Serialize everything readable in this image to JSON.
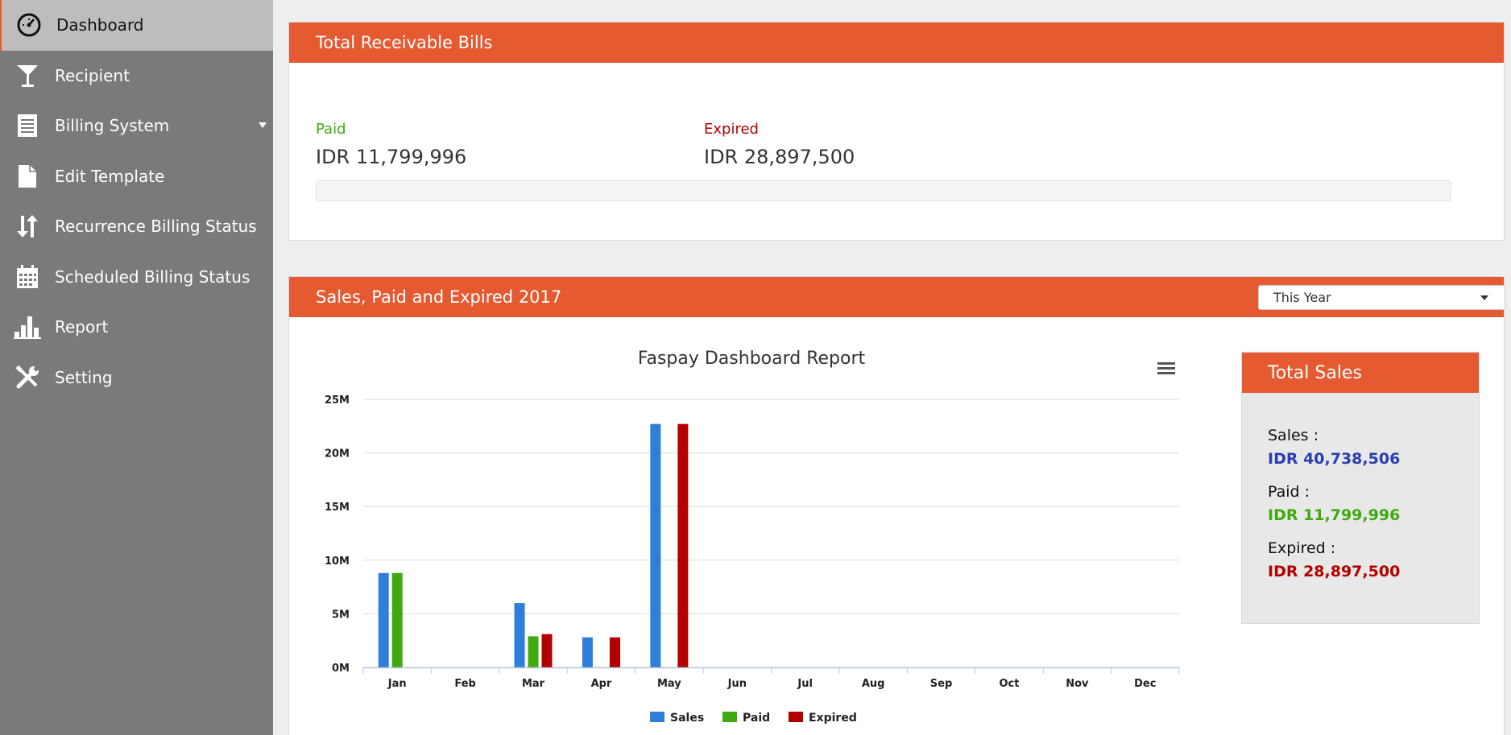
{
  "colors": {
    "accent": "#e55a30",
    "sales": "#2f7ed8",
    "paid": "#40a90f",
    "expired": "#b30000",
    "salesTotal": "#2b3db4"
  },
  "sidebar": {
    "items": [
      {
        "label": "Dashboard",
        "icon": "dashboard-gauge-icon",
        "active": true
      },
      {
        "label": "Recipient",
        "icon": "glass-icon"
      },
      {
        "label": "Billing System",
        "icon": "document-list-icon",
        "hasSubmenu": true
      },
      {
        "label": "Edit Template",
        "icon": "file-icon"
      },
      {
        "label": "Recurrence Billing Status",
        "icon": "sort-arrows-icon"
      },
      {
        "label": "Scheduled Billing Status",
        "icon": "calendar-icon"
      },
      {
        "label": "Report",
        "icon": "bar-chart-icon"
      },
      {
        "label": "Setting",
        "icon": "wrench-icon"
      }
    ]
  },
  "receivable": {
    "title": "Total Receivable Bills",
    "paid_label": "Paid",
    "paid_value": "IDR 11,799,996",
    "expired_label": "Expired",
    "expired_value": "IDR 28,897,500",
    "progress_paid_fraction": 0
  },
  "sales_panel": {
    "title": "Sales, Paid and Expired 2017",
    "period_selected": "This Year"
  },
  "total_sales": {
    "title": "Total Sales",
    "sales_label": "Sales :",
    "sales_value": "IDR 40,738,506",
    "paid_label": "Paid :",
    "paid_value": "IDR 11,799,996",
    "expired_label": "Expired :",
    "expired_value": "IDR 28,897,500"
  },
  "chart_data": {
    "type": "bar",
    "title": "Faspay Dashboard Report",
    "categories": [
      "Jan",
      "Feb",
      "Mar",
      "Apr",
      "May",
      "Jun",
      "Jul",
      "Aug",
      "Sep",
      "Oct",
      "Nov",
      "Dec"
    ],
    "series": [
      {
        "name": "Sales",
        "color": "#2f7ed8",
        "values": [
          8800000,
          0,
          6000000,
          2800000,
          22700000,
          0,
          0,
          0,
          0,
          0,
          0,
          0
        ]
      },
      {
        "name": "Paid",
        "color": "#40a90f",
        "values": [
          8800000,
          0,
          2900000,
          0,
          0,
          0,
          0,
          0,
          0,
          0,
          0,
          0
        ]
      },
      {
        "name": "Expired",
        "color": "#b30000",
        "values": [
          0,
          0,
          3100000,
          2800000,
          22700000,
          0,
          0,
          0,
          0,
          0,
          0,
          0
        ]
      }
    ],
    "ylim": [
      0,
      25000000
    ],
    "yticks": [
      0,
      5000000,
      10000000,
      15000000,
      20000000,
      25000000
    ],
    "ytick_labels": [
      "0M",
      "5M",
      "10M",
      "15M",
      "20M",
      "25M"
    ],
    "grid": true,
    "legend": "bottom-center"
  }
}
